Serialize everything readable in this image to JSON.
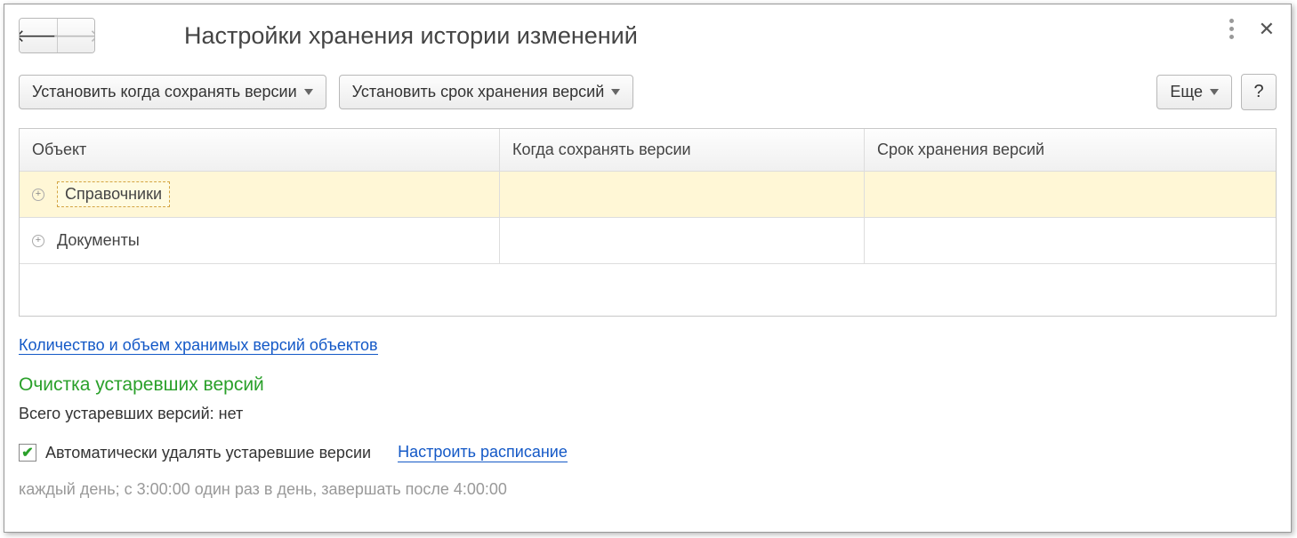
{
  "header": {
    "title": "Настройки хранения истории изменений"
  },
  "toolbar": {
    "set_when_label": "Установить когда сохранять версии",
    "set_retention_label": "Установить срок хранения версий",
    "more_label": "Еще",
    "help_label": "?"
  },
  "table": {
    "columns": {
      "object": "Объект",
      "when_save": "Когда сохранять версии",
      "retention": "Срок хранения версий"
    },
    "rows": [
      {
        "label": "Справочники",
        "when": "",
        "retention": ""
      },
      {
        "label": "Документы",
        "when": "",
        "retention": ""
      }
    ]
  },
  "links": {
    "count_volume": "Количество и объем хранимых версий объектов",
    "configure_schedule": "Настроить расписание"
  },
  "cleanup": {
    "section_title": "Очистка устаревших версий",
    "total_label": "Всего устаревших версий:",
    "total_value": "нет",
    "auto_delete_label": "Автоматически удалять устаревшие версии",
    "auto_delete_checked": true,
    "schedule_text": "каждый день; с 3:00:00 один раз в день, завершать после 4:00:00"
  }
}
